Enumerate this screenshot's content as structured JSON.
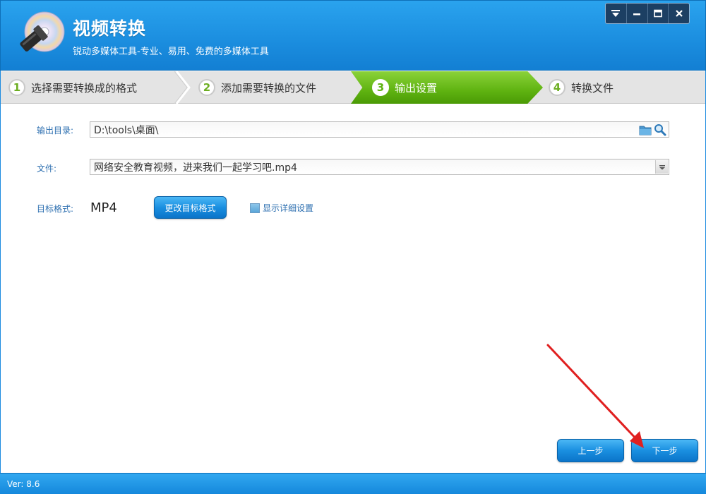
{
  "header": {
    "title": "视频转换",
    "subtitle": "锐动多媒体工具-专业、易用、免费的多媒体工具",
    "controls": [
      "menu-icon",
      "minimize-icon",
      "maximize-icon",
      "close-icon"
    ]
  },
  "steps": [
    {
      "num": "1",
      "label": "选择需要转换成的格式",
      "active": false
    },
    {
      "num": "2",
      "label": "添加需要转换的文件",
      "active": false
    },
    {
      "num": "3",
      "label": "输出设置",
      "active": true
    },
    {
      "num": "4",
      "label": "转换文件",
      "active": false
    }
  ],
  "form": {
    "output_dir_label": "输出目录:",
    "output_dir_value": "D:\\tools\\桌面\\",
    "file_label": "文件:",
    "file_value": "网络安全教育视频，进来我们一起学习吧.mp4",
    "format_label": "目标格式:",
    "format_value": "MP4",
    "change_format_button": "更改目标格式",
    "show_details_label": "显示详细设置",
    "show_details_checked": false
  },
  "nav": {
    "prev_button": "上一步",
    "next_button": "下一步"
  },
  "footer": {
    "version": "Ver: 8.6"
  },
  "colors": {
    "header_blue": "#1c8fe0",
    "active_step_green": "#5fb311",
    "label_blue": "#2d6fb0",
    "annotation_arrow": "#e02020"
  }
}
